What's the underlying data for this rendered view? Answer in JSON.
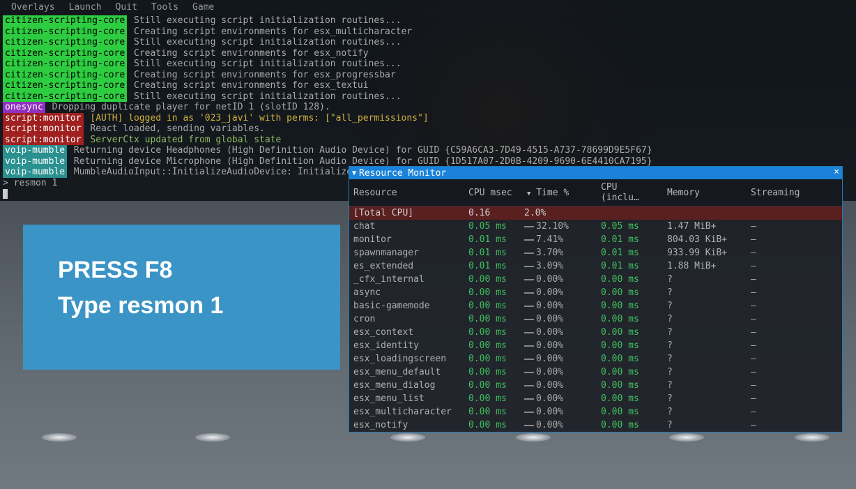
{
  "menubar": [
    "Overlays",
    "Launch",
    "Quit",
    "Tools",
    "Game"
  ],
  "console_lines": [
    {
      "tag": "citizen-scripting-core",
      "tagClass": "green",
      "msg": "Still executing script initialization routines...",
      "msgClass": ""
    },
    {
      "tag": "citizen-scripting-core",
      "tagClass": "green",
      "msg": "Creating script environments for esx_multicharacter",
      "msgClass": ""
    },
    {
      "tag": "citizen-scripting-core",
      "tagClass": "green",
      "msg": "Still executing script initialization routines...",
      "msgClass": ""
    },
    {
      "tag": "citizen-scripting-core",
      "tagClass": "green",
      "msg": "Creating script environments for esx_notify",
      "msgClass": ""
    },
    {
      "tag": "citizen-scripting-core",
      "tagClass": "green",
      "msg": "Still executing script initialization routines...",
      "msgClass": ""
    },
    {
      "tag": "citizen-scripting-core",
      "tagClass": "green",
      "msg": "Creating script environments for esx_progressbar",
      "msgClass": ""
    },
    {
      "tag": "citizen-scripting-core",
      "tagClass": "green",
      "msg": "Creating script environments for esx_textui",
      "msgClass": ""
    },
    {
      "tag": "citizen-scripting-core",
      "tagClass": "green",
      "msg": "Still executing script initialization routines...",
      "msgClass": ""
    },
    {
      "tag": "onesync",
      "tagClass": "magenta",
      "msg": "Dropping duplicate player for netID 1 (slotID 128).",
      "msgClass": ""
    },
    {
      "tag": "script:monitor",
      "tagClass": "darkred",
      "msg": "[AUTH] logged in as '023_javi' with perms: [\"all_permissions\"]",
      "msgClass": "yellow"
    },
    {
      "tag": "script:monitor",
      "tagClass": "darkred",
      "msg": "React loaded, sending variables.",
      "msgClass": ""
    },
    {
      "tag": "script:monitor",
      "tagClass": "darkred",
      "msg": "ServerCtx updated from global state",
      "msgClass": "greenish"
    },
    {
      "tag": "voip-mumble",
      "tagClass": "cyan",
      "msg": "Returning device Headphones (High Definition Audio Device) for GUID {C59A6CA3-7D49-4515-A737-78699D9E5F67}",
      "msgClass": ""
    },
    {
      "tag": "voip-mumble",
      "tagClass": "cyan",
      "msg": "Returning device Microphone (High Definition Audio Device) for GUID {1D517A07-2D0B-4209-9690-6E4410CA7195}",
      "msgClass": ""
    },
    {
      "tag": "voip-mumble",
      "tagClass": "cyan",
      "msg": "MumbleAudioInput::InitializeAudioDevice: Initialized au",
      "msgClass": ""
    }
  ],
  "prompt": "> resmon 1",
  "instruction": {
    "line1": "PRESS F8",
    "line2": "Type resmon 1"
  },
  "resmon": {
    "title": "Resource Monitor",
    "columns": [
      "Resource",
      "CPU msec",
      "Time %",
      "CPU (inclu…",
      "Memory",
      "Streaming"
    ],
    "rows": [
      {
        "name": "[Total CPU]",
        "cpu": "0.16",
        "time": "2.0%",
        "incl": "",
        "mem": "",
        "stream": "",
        "total": true,
        "bar": 0
      },
      {
        "name": "chat",
        "cpu": "0.05 ms",
        "time": "32.10%",
        "incl": "0.05 ms",
        "mem": "1.47 MiB+",
        "stream": "–",
        "bar": 14
      },
      {
        "name": "monitor",
        "cpu": "0.01 ms",
        "time": "7.41%",
        "incl": "0.01 ms",
        "mem": "804.03 KiB+",
        "stream": "–",
        "bar": 14
      },
      {
        "name": "spawnmanager",
        "cpu": "0.01 ms",
        "time": "3.70%",
        "incl": "0.01 ms",
        "mem": "933.99 KiB+",
        "stream": "–",
        "bar": 14
      },
      {
        "name": "es_extended",
        "cpu": "0.01 ms",
        "time": "3.09%",
        "incl": "0.01 ms",
        "mem": "1.88 MiB+",
        "stream": "–",
        "bar": 14
      },
      {
        "name": "_cfx_internal",
        "cpu": "0.00 ms",
        "time": "0.00%",
        "incl": "0.00 ms",
        "mem": "?",
        "stream": "–",
        "bar": 14
      },
      {
        "name": "async",
        "cpu": "0.00 ms",
        "time": "0.00%",
        "incl": "0.00 ms",
        "mem": "?",
        "stream": "–",
        "bar": 14
      },
      {
        "name": "basic-gamemode",
        "cpu": "0.00 ms",
        "time": "0.00%",
        "incl": "0.00 ms",
        "mem": "?",
        "stream": "–",
        "bar": 14
      },
      {
        "name": "cron",
        "cpu": "0.00 ms",
        "time": "0.00%",
        "incl": "0.00 ms",
        "mem": "?",
        "stream": "–",
        "bar": 14
      },
      {
        "name": "esx_context",
        "cpu": "0.00 ms",
        "time": "0.00%",
        "incl": "0.00 ms",
        "mem": "?",
        "stream": "–",
        "bar": 14
      },
      {
        "name": "esx_identity",
        "cpu": "0.00 ms",
        "time": "0.00%",
        "incl": "0.00 ms",
        "mem": "?",
        "stream": "–",
        "bar": 14
      },
      {
        "name": "esx_loadingscreen",
        "cpu": "0.00 ms",
        "time": "0.00%",
        "incl": "0.00 ms",
        "mem": "?",
        "stream": "–",
        "bar": 14
      },
      {
        "name": "esx_menu_default",
        "cpu": "0.00 ms",
        "time": "0.00%",
        "incl": "0.00 ms",
        "mem": "?",
        "stream": "–",
        "bar": 14
      },
      {
        "name": "esx_menu_dialog",
        "cpu": "0.00 ms",
        "time": "0.00%",
        "incl": "0.00 ms",
        "mem": "?",
        "stream": "–",
        "bar": 14
      },
      {
        "name": "esx_menu_list",
        "cpu": "0.00 ms",
        "time": "0.00%",
        "incl": "0.00 ms",
        "mem": "?",
        "stream": "–",
        "bar": 14
      },
      {
        "name": "esx_multicharacter",
        "cpu": "0.00 ms",
        "time": "0.00%",
        "incl": "0.00 ms",
        "mem": "?",
        "stream": "–",
        "bar": 14
      },
      {
        "name": "esx_notify",
        "cpu": "0.00 ms",
        "time": "0.00%",
        "incl": "0.00 ms",
        "mem": "?",
        "stream": "–",
        "bar": 14
      }
    ]
  }
}
